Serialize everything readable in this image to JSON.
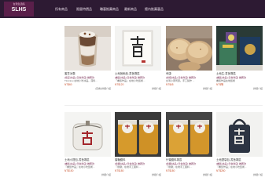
{
  "header": {
    "logo_top": "台灣生活館",
    "logo_main": "SLHS",
    "nav": [
      "所有商品",
      "限量特價品",
      "職藝推薦商品",
      "最新商品",
      "館內推薦藝品"
    ]
  },
  "products": [
    {
      "title": "蜜豆冰霸",
      "sub": "[蜜豆]冰品 [日常商店] 推薦款",
      "desc": "Tiramisu 在地小吃冰品。滿料...",
      "price": "NT$60",
      "more": "(查看)詳細介紹"
    },
    {
      "title": "土地藝術品-書藝專區",
      "sub": "[書藝]冰品 [日常商店] 推薦款",
      "desc": "『書藝作品』在地小吃藝術...",
      "price": "NT$120",
      "more": "詳細介紹"
    },
    {
      "title": "司康",
      "sub": "[烘焙]冰品 [日常商店] 推薦款",
      "desc": "台灣小麥司康。手工製作 ...",
      "price": "NT$45",
      "more": "詳細介紹"
    },
    {
      "title": "土地生-書藝專區",
      "sub": "[書藝]冰品 [日常商店] 推薦款",
      "desc": "書藝作品在地藝術",
      "price": "NT$等",
      "more": "詳細介紹"
    },
    {
      "title": "土地小提包-書藝專區",
      "sub": "[書藝]冰品 [日常商店] 推薦款",
      "desc": "『書藝作品』在地小吃藝術...",
      "price": "NT$150",
      "more": "詳細介紹"
    },
    {
      "title": "蜜糖醬料",
      "sub": "[蜜糖]冰品 [日常商店] 推薦款",
      "desc": "『蜜糖』在地手工醬料 ...",
      "price": "NT$180",
      "more": "詳細介紹"
    },
    {
      "title": "什蜜醬料專區",
      "sub": "[蜜糖]冰品 [日常商店] 推薦款",
      "desc": "『蜜糖』在地手工醬料 ...",
      "price": "NT$180",
      "more": "詳細介紹"
    },
    {
      "title": "土地提袋包-書藝專區",
      "sub": "[書藝]冰品 [日常商店] 推薦款",
      "desc": "『書藝作品』在地小吃藝術...",
      "price": "NT$280",
      "more": "詳細介紹"
    }
  ],
  "colors": {
    "topbar": "#2d1a33",
    "logo_bg": "#5a1f4a",
    "price": "#c8522e"
  }
}
